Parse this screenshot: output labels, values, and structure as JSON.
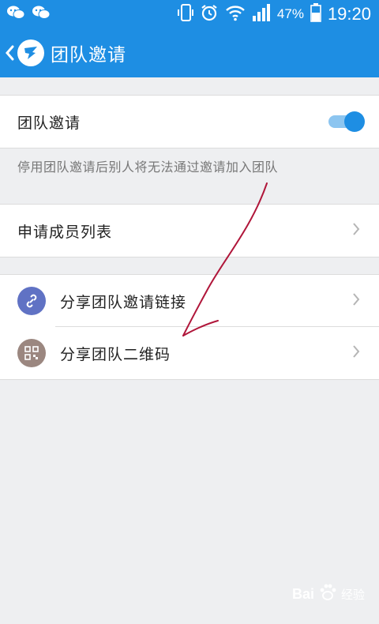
{
  "status_bar": {
    "battery_percent": "47%",
    "time": "19:20",
    "icons": [
      "wechat-icon",
      "wechat-icon",
      "vibrate-icon",
      "alarm-icon",
      "wifi-icon",
      "signal-icon",
      "battery-icon"
    ]
  },
  "header": {
    "title": "团队邀请",
    "back_icon": "chevron-left-icon",
    "logo_icon": "dingtalk-logo"
  },
  "team_invite": {
    "label": "团队邀请",
    "toggle_on": true,
    "hint": "停用团队邀请后别人将无法通过邀请加入团队"
  },
  "applicants": {
    "label": "申请成员列表"
  },
  "share": {
    "items": [
      {
        "label": "分享团队邀请链接",
        "icon": "link-icon",
        "icon_color": "#6072c4"
      },
      {
        "label": "分享团队二维码",
        "icon": "qrcode-icon",
        "icon_color": "#9b8780"
      }
    ]
  },
  "watermark": {
    "brand": "Bai",
    "sub": "经验",
    "logo_icon": "baidu-paw-icon"
  },
  "colors": {
    "accent": "#1e8ee3",
    "background": "#eeeff1",
    "annotation": "#b0163a"
  }
}
